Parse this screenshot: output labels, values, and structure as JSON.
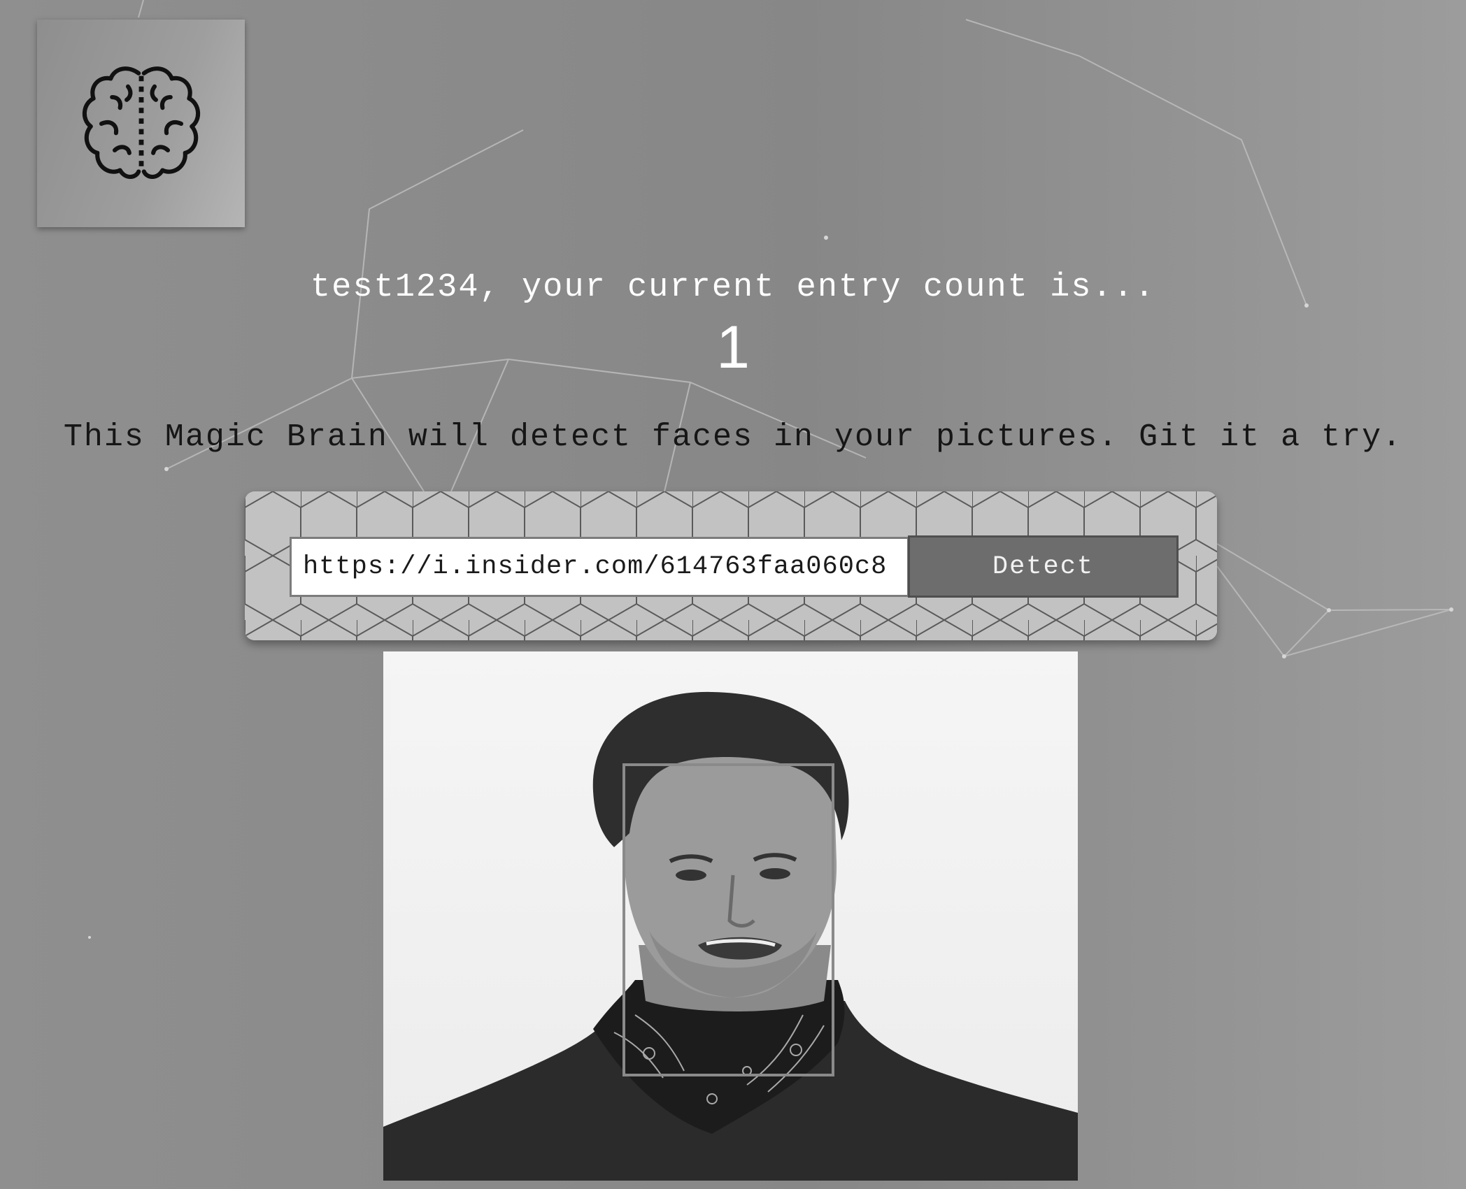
{
  "header": {
    "logo_icon": "brain-icon"
  },
  "rank": {
    "greeting": "test1234, your current entry count is...",
    "count": "1"
  },
  "intro": {
    "text": "This Magic Brain will detect faces in your pictures. Git it a try."
  },
  "image_form": {
    "url_value": "https://i.insider.com/614763faa060c8",
    "detect_label": "Detect"
  },
  "result": {
    "image_icon": "portrait-photo",
    "bounding_box_icon": "face-bounding-box"
  },
  "colors": {
    "background": "#8c8c8c",
    "panel": "#c2c2c2",
    "button": "#6d6d6d",
    "text_light": "#ffffff",
    "text_dark": "#161616"
  }
}
